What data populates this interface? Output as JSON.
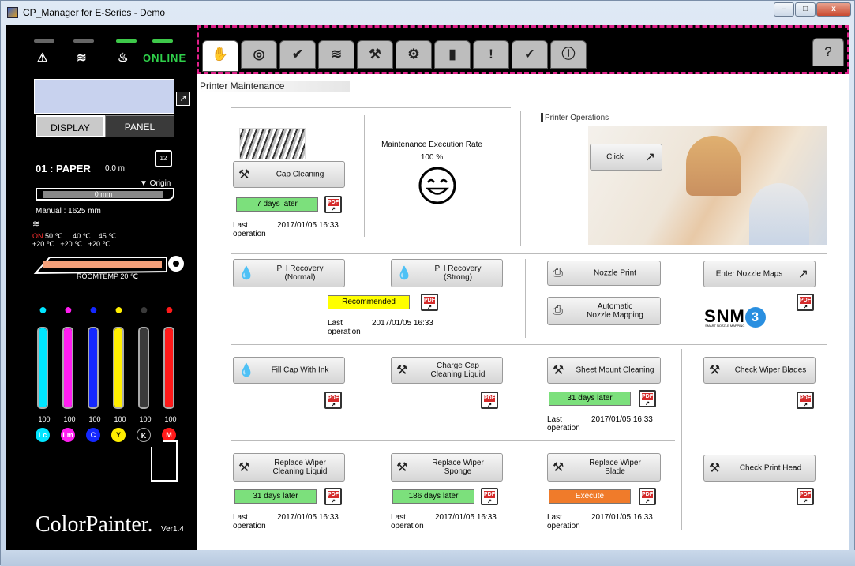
{
  "window": {
    "title": "CP_Manager for E-Series - Demo",
    "controls": [
      "–",
      "□",
      "x"
    ]
  },
  "status": {
    "online": "ONLINE",
    "icons": [
      "warning-icon",
      "heater-icon",
      "ink-icon"
    ]
  },
  "display": {
    "display_btn": "DISPLAY",
    "panel_btn": "PANEL"
  },
  "media": {
    "label": "01 : PAPER",
    "value": "0.0  m",
    "origin": "▼ Origin",
    "bar_value": "0  mm",
    "manual": "Manual : 1625  mm"
  },
  "heater": {
    "symbol": "≋",
    "on": "ON",
    "temps_row1": " 50 ℃     40 ℃    45 ℃",
    "temps_row2": "+20 ℃   +20 ℃   +20 ℃",
    "roomtemp": "ROOMTEMP  20 ℃"
  },
  "inks": [
    {
      "code": "Lc",
      "level": "100",
      "color": "#00e5ff"
    },
    {
      "code": "Lm",
      "level": "100",
      "color": "#ff1ef0"
    },
    {
      "code": "C",
      "level": "100",
      "color": "#1428ff"
    },
    {
      "code": "Y",
      "level": "100",
      "color": "#ffee00"
    },
    {
      "code": "K",
      "level": "100",
      "color": "#3a3a3a"
    },
    {
      "code": "M",
      "level": "100",
      "color": "#ff1a1a"
    }
  ],
  "brand": {
    "name": "ColorPainter.",
    "version": "Ver1.4"
  },
  "tabs": [
    {
      "icon": "maintenance-hand-icon",
      "glyph": "✋"
    },
    {
      "icon": "nozzle-check-icon",
      "glyph": "◎"
    },
    {
      "icon": "nozzle-verify-icon",
      "glyph": "✔"
    },
    {
      "icon": "heater-tab-icon",
      "glyph": "≋"
    },
    {
      "icon": "tools-tab-icon",
      "glyph": "⚒"
    },
    {
      "icon": "settings-search-icon",
      "glyph": "⚙"
    },
    {
      "icon": "ink-gauge-icon",
      "glyph": "▮"
    },
    {
      "icon": "alert-icon",
      "glyph": "!"
    },
    {
      "icon": "checklist-icon",
      "glyph": "✓"
    },
    {
      "icon": "info-icon",
      "glyph": "ⓘ"
    }
  ],
  "help_glyph": "?",
  "page_title": "Printer Maintenance",
  "cap": {
    "button": "Cap Cleaning",
    "status": "7 days later",
    "last_label": "Last\noperation",
    "last_date": "2017/01/05 16:33"
  },
  "rate": {
    "label": "Maintenance Execution Rate",
    "value": "100 %"
  },
  "operations": {
    "title": "Printer Operations",
    "click": "Click"
  },
  "ph": {
    "normal": "PH Recovery\n(Normal)",
    "strong": "PH Recovery\n(Strong)",
    "status": "Recommended",
    "last_label": "Last\noperation",
    "last_date": "2017/01/05 16:33"
  },
  "nozzle": {
    "print": "Nozzle Print",
    "auto": "Automatic\nNozzle Mapping",
    "enter": "Enter Nozzle Maps",
    "logo": "SNM",
    "logo_num": "3",
    "logo_sub": "SMART NOZZLE MAPPING"
  },
  "row3": {
    "fill_cap": "Fill Cap With Ink",
    "charge_cap": "Charge Cap\nCleaning Liquid",
    "sheet_mount": "Sheet Mount Cleaning",
    "sheet_status": "31 days later",
    "last_label": "Last\noperation",
    "last_date": "2017/01/05 16:33",
    "check_wiper": "Check Wiper Blades"
  },
  "row4": {
    "wiper_liquid": "Replace Wiper\nCleaning Liquid",
    "wiper_liquid_status": "31 days later",
    "wiper_sponge": "Replace Wiper\nSponge",
    "wiper_sponge_status": "186 days later",
    "wiper_blade": "Replace Wiper\nBlade",
    "wiper_blade_status": "Execute",
    "last_label": "Last\noperation",
    "last_date": "2017/01/05 16:33",
    "check_head": "Check Print Head"
  },
  "pdf_label": "PDF"
}
